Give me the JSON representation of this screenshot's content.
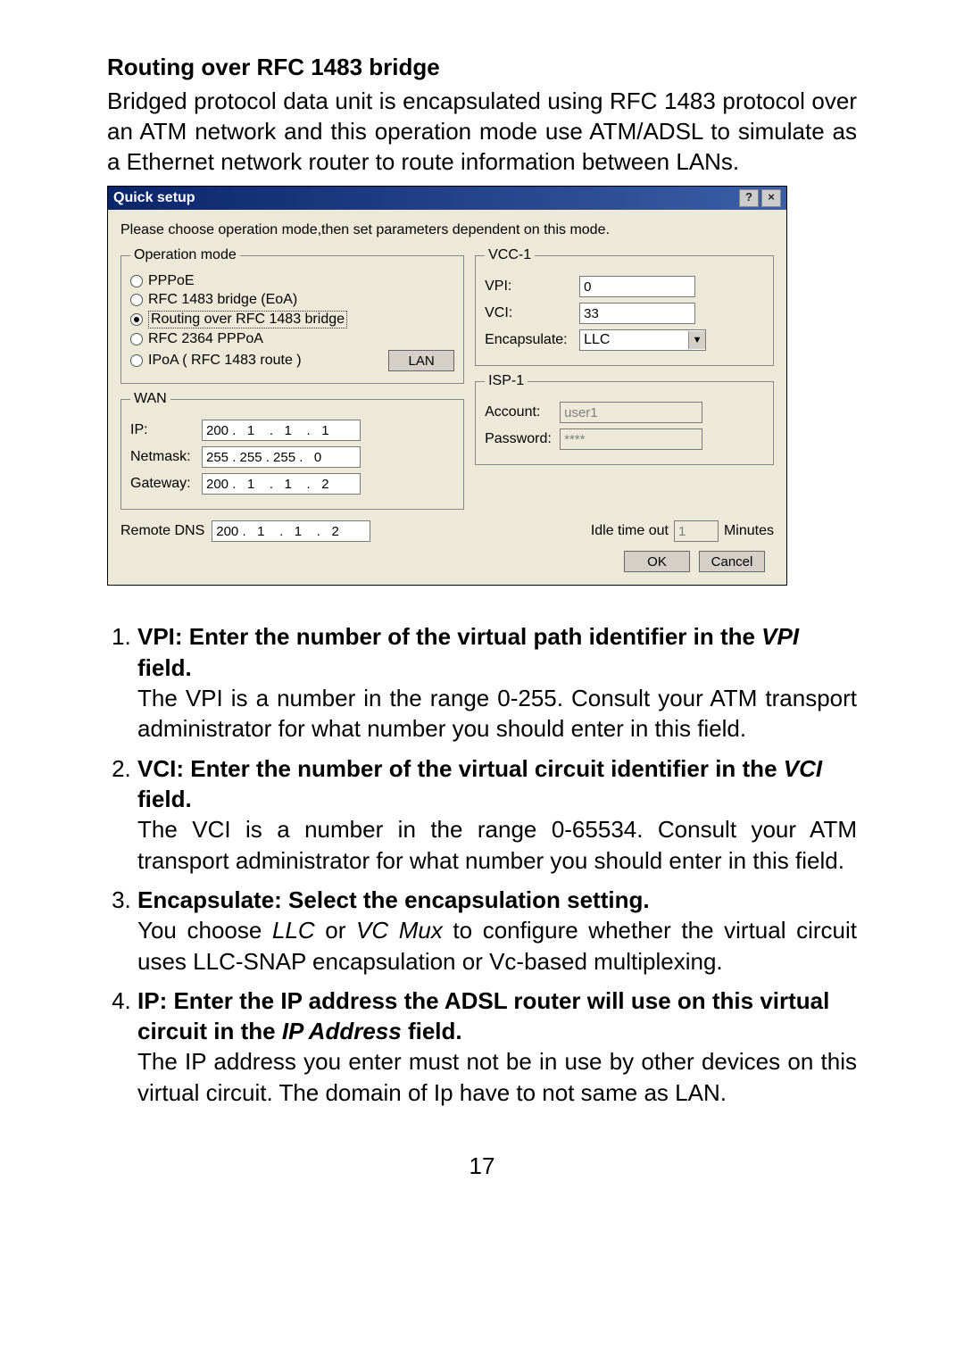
{
  "doc": {
    "heading": "Routing over RFC 1483 bridge",
    "intro": "Bridged protocol data unit is encapsulated using RFC 1483 protocol over an ATM network and this operation mode use ATM/ADSL to simulate as a Ethernet network router to route information between LANs.",
    "page_number": "17"
  },
  "dialog": {
    "title": "Quick setup",
    "help_btn": "?",
    "close_btn": "×",
    "instruction": "Please choose operation mode,then set parameters dependent on  this mode.",
    "op_legend": "Operation mode",
    "op_pppoe": "PPPoE",
    "op_rfc1483": "RFC 1483 bridge (EoA)",
    "op_routing": "Routing over RFC 1483 bridge",
    "op_rfc2364": "RFC 2364 PPPoA",
    "op_ipoa": "IPoA ( RFC 1483 route )",
    "btn_lan": "LAN",
    "wan_legend": "WAN",
    "wan_ip_label": "IP:",
    "wan_ip_val": "200 .   1    .   1    .   1",
    "wan_nm_label": "Netmask:",
    "wan_nm_val": "255 . 255 . 255 .   0",
    "wan_gw_label": "Gateway:",
    "wan_gw_val": "200 .   1    .   1    .   2",
    "vcc_legend": "VCC-1",
    "vpi_label": "VPI:",
    "vpi_val": "0",
    "vci_label": "VCI:",
    "vci_val": "33",
    "encap_label": "Encapsulate:",
    "encap_val": "LLC",
    "isp_legend": "ISP-1",
    "acct_label": "Account:",
    "acct_val": "user1",
    "pwd_label": "Password:",
    "pwd_val": "****",
    "dns_label": "Remote DNS",
    "dns_val": "200 .   1    .   1    .   2",
    "idle_label": "Idle time out",
    "idle_val": "1",
    "idle_unit": "Minutes",
    "btn_ok": "OK",
    "btn_cancel": "Cancel"
  },
  "inst": {
    "i1_head_a": "VPI: Enter the number of the virtual path identifier in the ",
    "i1_head_b": "VPI",
    "i1_head_c": " field.",
    "i1_body": "The VPI is a number in the range 0-255. Consult your ATM transport administrator for what number you should enter in this field.",
    "i2_head_a": "VCI: Enter the number of the virtual circuit identifier in the ",
    "i2_head_b": "VCI",
    "i2_head_c": " field.",
    "i2_body": "The VCI is a number in the range 0-65534. Consult your ATM transport administrator for what number you should enter in this field.",
    "i3_head": "Encapsulate: Select the encapsulation setting.",
    "i3_body_a": "You choose ",
    "i3_body_b": "LLC",
    "i3_body_c": " or ",
    "i3_body_d": "VC Mux",
    "i3_body_e": " to configure whether the virtual circuit uses LLC-SNAP encapsulation or Vc-based multiplexing.",
    "i4_head_a": " IP: Enter the IP address the ADSL router will use on this virtual circuit in the ",
    "i4_head_b": "IP Address",
    "i4_head_c": " field.",
    "i4_body": "The IP address you enter must not be in use by other devices on this virtual circuit.  The domain of Ip have to not same as LAN."
  }
}
